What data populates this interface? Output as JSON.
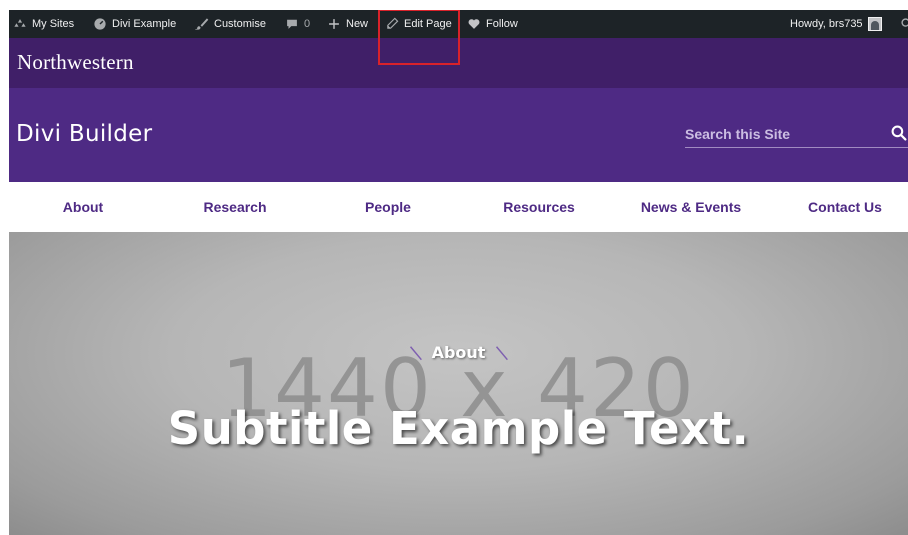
{
  "admin_bar": {
    "my_sites": "My Sites",
    "site_name": "Divi Example",
    "customise": "Customise",
    "comments_count": "0",
    "new": "New",
    "edit_page": "Edit Page",
    "follow": "Follow",
    "howdy": "Howdy, brs735"
  },
  "brand": {
    "logo_text": "Northwestern"
  },
  "header": {
    "site_title": "Divi Builder",
    "search_placeholder": "Search this Site"
  },
  "nav": {
    "items": [
      "About",
      "Research",
      "People",
      "Resources",
      "News & Events",
      "Contact Us"
    ]
  },
  "hero": {
    "placeholder_text": "1440 x 420",
    "kicker": "About",
    "title": "Subtitle Example Text."
  },
  "colors": {
    "admin_bar": "#1d2327",
    "brand_bar": "#401f68",
    "header": "#4e2a84",
    "nav_text": "#4e2a84",
    "highlight": "#d9222a"
  }
}
